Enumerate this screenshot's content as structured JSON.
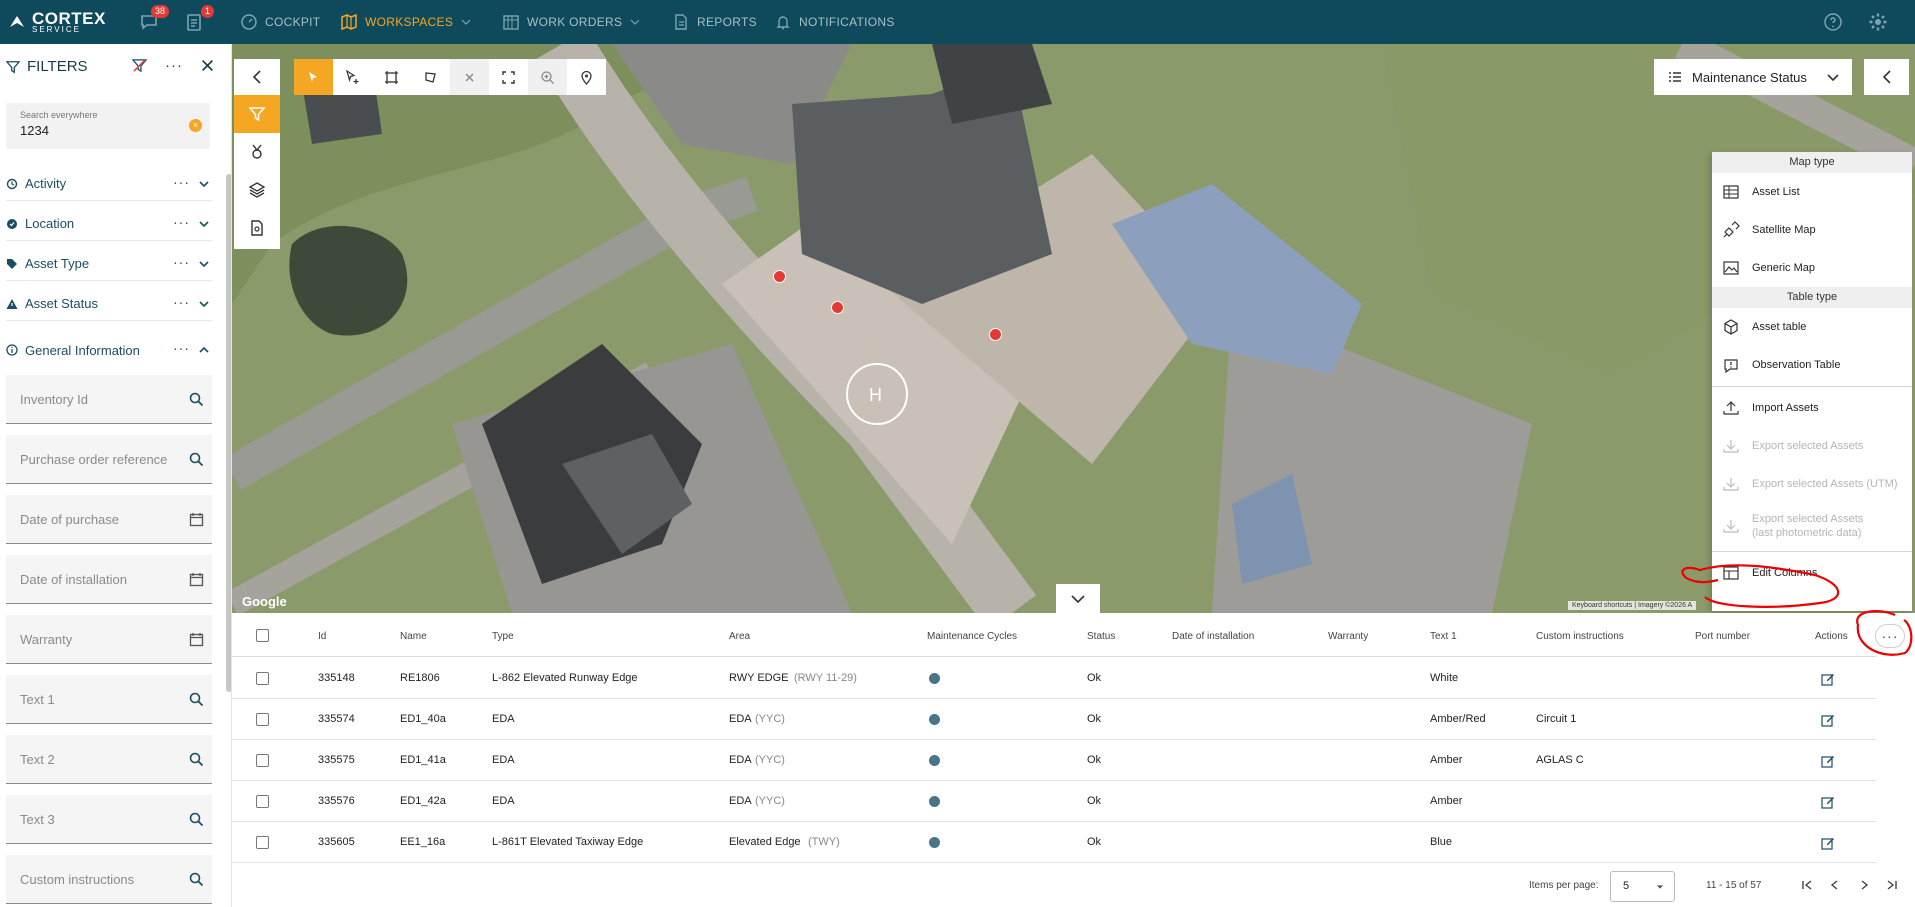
{
  "brand": {
    "name": "CORTEX",
    "sub": "SERVICE"
  },
  "topbar": {
    "chat_badge": "38",
    "task_badge": "1",
    "nav": [
      {
        "label": "COCKPIT"
      },
      {
        "label": "WORKSPACES"
      },
      {
        "label": "WORK ORDERS"
      },
      {
        "label": "REPORTS"
      },
      {
        "label": "NOTIFICATIONS"
      }
    ],
    "accent": "#f5a623",
    "bg": "#0e4a5c"
  },
  "filters": {
    "title": "FILTERS",
    "search_label": "Search everywhere",
    "search_value": "1234",
    "sections": [
      "Activity",
      "Location",
      "Asset Type",
      "Asset Status",
      "General Information"
    ],
    "fields": [
      "Inventory Id",
      "Purchase order reference",
      "Date of purchase",
      "Date of installation",
      "Warranty",
      "Text 1",
      "Text 2",
      "Text 3",
      "Custom instructions"
    ]
  },
  "map": {
    "status_dropdown": "Maintenance Status",
    "google": "Google",
    "attribution": "Keyboard shortcuts | Imagery ©2026 A"
  },
  "menu": {
    "map_type_header": "Map type",
    "map_types": [
      "Asset List",
      "Satellite Map",
      "Generic Map"
    ],
    "table_type_header": "Table type",
    "table_types": [
      "Asset table",
      "Observation Table"
    ],
    "import": "Import Assets",
    "export_selected": "Export selected Assets",
    "export_utm": "Export selected Assets (UTM)",
    "export_photo_1": "Export selected Assets",
    "export_photo_2": "(last photometric data)",
    "edit_columns": "Edit Columns"
  },
  "table": {
    "columns": [
      "Id",
      "Name",
      "Type",
      "Area",
      "Maintenance Cycles",
      "Status",
      "Date of installation",
      "Warranty",
      "Text 1",
      "Custom instructions",
      "Port number",
      "Actions"
    ],
    "rows": [
      {
        "id": "335148",
        "name": "RE1806",
        "type": "L-862 Elevated Runway Edge",
        "area": "RWY EDGE",
        "area_sub": "(RWY 11-29)",
        "status": "Ok",
        "text1": "White",
        "custom": ""
      },
      {
        "id": "335574",
        "name": "ED1_40a",
        "type": "EDA",
        "area": "EDA",
        "area_sub": "(YYC)",
        "status": "Ok",
        "text1": "Amber/Red",
        "custom": "Circuit 1"
      },
      {
        "id": "335575",
        "name": "ED1_41a",
        "type": "EDA",
        "area": "EDA",
        "area_sub": "(YYC)",
        "status": "Ok",
        "text1": "Amber",
        "custom": "AGLAS C"
      },
      {
        "id": "335576",
        "name": "ED1_42a",
        "type": "EDA",
        "area": "EDA",
        "area_sub": "(YYC)",
        "status": "Ok",
        "text1": "Amber",
        "custom": ""
      },
      {
        "id": "335605",
        "name": "EE1_16a",
        "type": "L-861T Elevated Taxiway Edge",
        "area": "Elevated Edge",
        "area_sub": "(TWY)",
        "status": "Ok",
        "text1": "Blue",
        "custom": ""
      }
    ],
    "items_per_page_label": "Items per page:",
    "items_per_page": "5",
    "range": "11 - 15 of 57"
  }
}
